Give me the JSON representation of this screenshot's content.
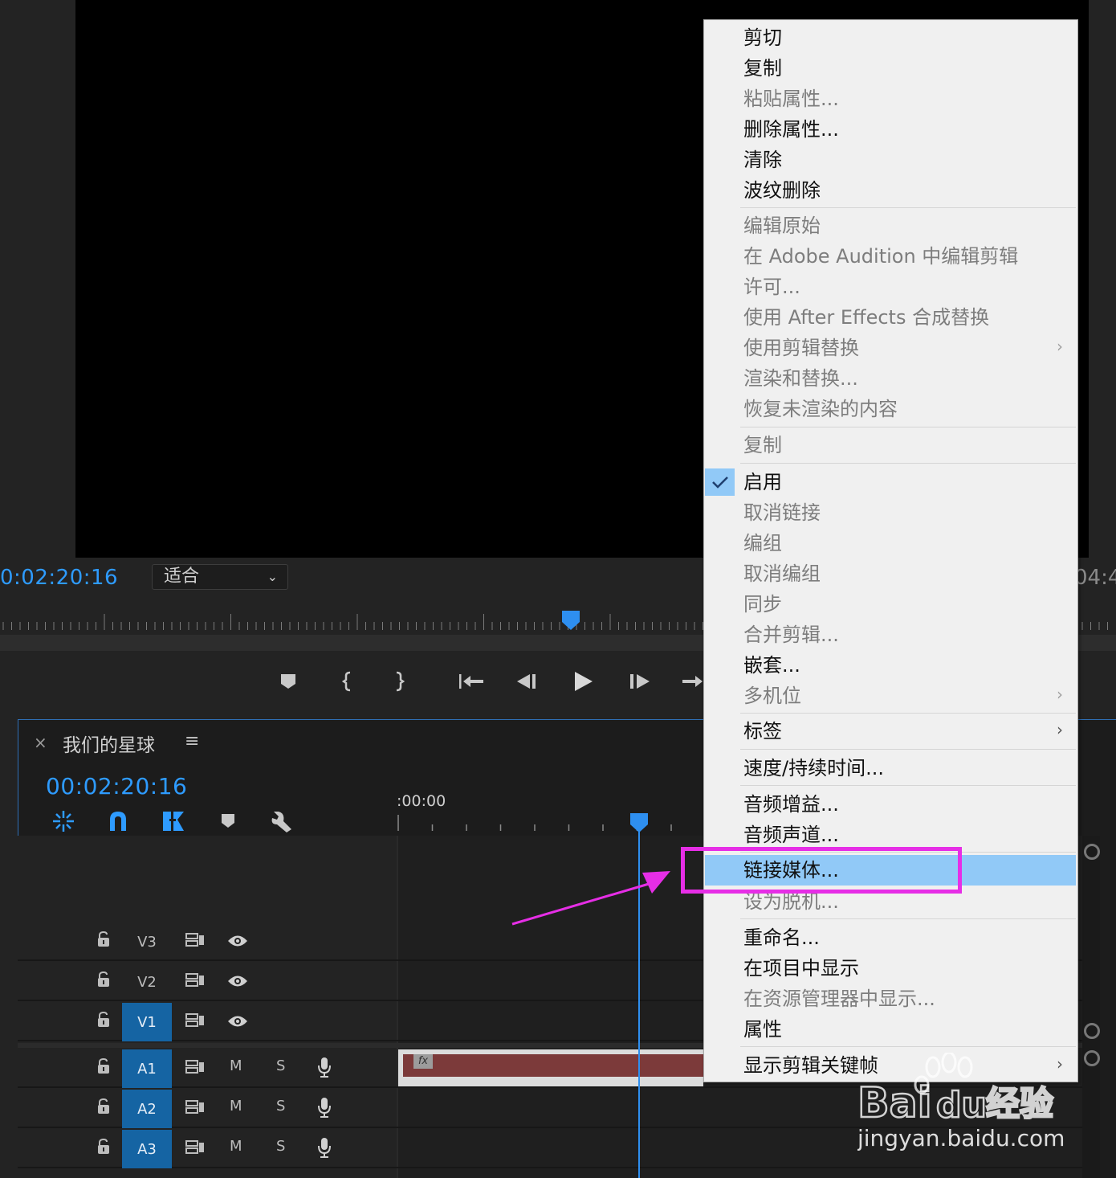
{
  "monitor": {
    "timecode": "0:02:20:16",
    "fit_value": "适合",
    "timecode_right": "04:4"
  },
  "timeline": {
    "close": "×",
    "sequence_name": "我们的星球",
    "menu": "≡",
    "timecode": "00:02:20:16",
    "ruler_time": ":00:00",
    "tracks": [
      {
        "name": "V3",
        "on": false,
        "kind": "video"
      },
      {
        "name": "V2",
        "on": false,
        "kind": "video"
      },
      {
        "name": "V1",
        "on": true,
        "kind": "video"
      },
      {
        "name": "A1",
        "on": true,
        "kind": "audio",
        "m": "M",
        "s": "S"
      },
      {
        "name": "A2",
        "on": true,
        "kind": "audio",
        "m": "M",
        "s": "S"
      },
      {
        "name": "A3",
        "on": true,
        "kind": "audio",
        "m": "M",
        "s": "S"
      }
    ],
    "clip_fx": "fx"
  },
  "context_menu": {
    "items": [
      {
        "label": "剪切",
        "enabled": true
      },
      {
        "label": "复制",
        "enabled": true
      },
      {
        "label": "粘贴属性...",
        "enabled": false
      },
      {
        "label": "删除属性...",
        "enabled": true
      },
      {
        "label": "清除",
        "enabled": true
      },
      {
        "label": "波纹删除",
        "enabled": true
      },
      {
        "label": "编辑原始",
        "enabled": false
      },
      {
        "label": "在 Adobe Audition 中编辑剪辑",
        "enabled": false
      },
      {
        "label": "许可...",
        "enabled": false
      },
      {
        "label": "使用 After Effects 合成替换",
        "enabled": false
      },
      {
        "label": "使用剪辑替换",
        "enabled": false,
        "submenu": true
      },
      {
        "label": "渲染和替换...",
        "enabled": false
      },
      {
        "label": "恢复未渲染的内容",
        "enabled": false
      },
      {
        "label": "复制",
        "enabled": false
      },
      {
        "label": "启用",
        "enabled": true,
        "checked": true
      },
      {
        "label": "取消链接",
        "enabled": false
      },
      {
        "label": "编组",
        "enabled": false
      },
      {
        "label": "取消编组",
        "enabled": false
      },
      {
        "label": "同步",
        "enabled": false
      },
      {
        "label": "合并剪辑...",
        "enabled": false
      },
      {
        "label": "嵌套...",
        "enabled": true
      },
      {
        "label": "多机位",
        "enabled": false,
        "submenu": true
      },
      {
        "label": "标签",
        "enabled": true,
        "submenu": true
      },
      {
        "label": "速度/持续时间...",
        "enabled": true
      },
      {
        "label": "音频增益...",
        "enabled": true
      },
      {
        "label": "音频声道...",
        "enabled": true
      },
      {
        "label": "链接媒体...",
        "enabled": true,
        "highlighted": true
      },
      {
        "label": "设为脱机...",
        "enabled": false
      },
      {
        "label": "重命名...",
        "enabled": true
      },
      {
        "label": "在项目中显示",
        "enabled": true
      },
      {
        "label": "在资源管理器中显示...",
        "enabled": false
      },
      {
        "label": "属性",
        "enabled": true
      },
      {
        "label": "显示剪辑关键帧",
        "enabled": true,
        "submenu": true
      }
    ]
  },
  "watermark": {
    "brand": "Bai",
    "brand2": "du",
    "cn": "经验",
    "url": "jingyan.baidu.com"
  },
  "colors": {
    "accent": "#2e9bff",
    "highlight": "#91c9f7",
    "annotation": "#e62ee6"
  }
}
